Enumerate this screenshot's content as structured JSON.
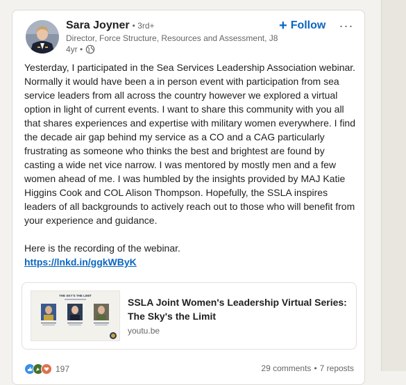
{
  "author": {
    "name": "Sara Joyner",
    "degree": "• 3rd+",
    "headline": "Director, Force Structure, Resources and Assessment, J8",
    "time": "4yr •",
    "visibility_icon": "globe-icon"
  },
  "actions": {
    "follow_label": "Follow",
    "more_label": "···"
  },
  "post": {
    "body": "Yesterday, I participated in the Sea Services Leadership Association webinar. Normally it would have been a in person event with participation from sea service leaders from all across the country however we explored a virtual option in light of current events. I want to share this community with you all that shares experiences and expertise with military women everywhere. I find the decade air gap behind my service as a CO and a CAG particularly frustrating as someone who thinks the best and brightest are found by casting a wide net vice narrow. I was mentored by mostly men and a few women ahead of me. I was humbled by the insights provided by MAJ Katie Higgins Cook and COL Alison Thompson. Hopefully, the SSLA inspires leaders of all backgrounds to actively reach out to those who will benefit from your experience and guidance.",
    "recording_line": "Here is the recording of the webinar.",
    "link_text": "https://lnkd.in/ggkWByK"
  },
  "preview": {
    "title": "SSLA Joint Women's Leadership Virtual Series: The Sky's the Limit",
    "source": "youtu.be",
    "thumb_heading": "THE SKY'S THE LIMIT"
  },
  "social": {
    "reaction_count": "197",
    "comments": "29 comments",
    "separator": "•",
    "reposts": "7 reposts"
  },
  "colors": {
    "accent": "#0a66c2",
    "like": "#378fe9",
    "celebrate": "#44712e",
    "love": "#df704d"
  }
}
